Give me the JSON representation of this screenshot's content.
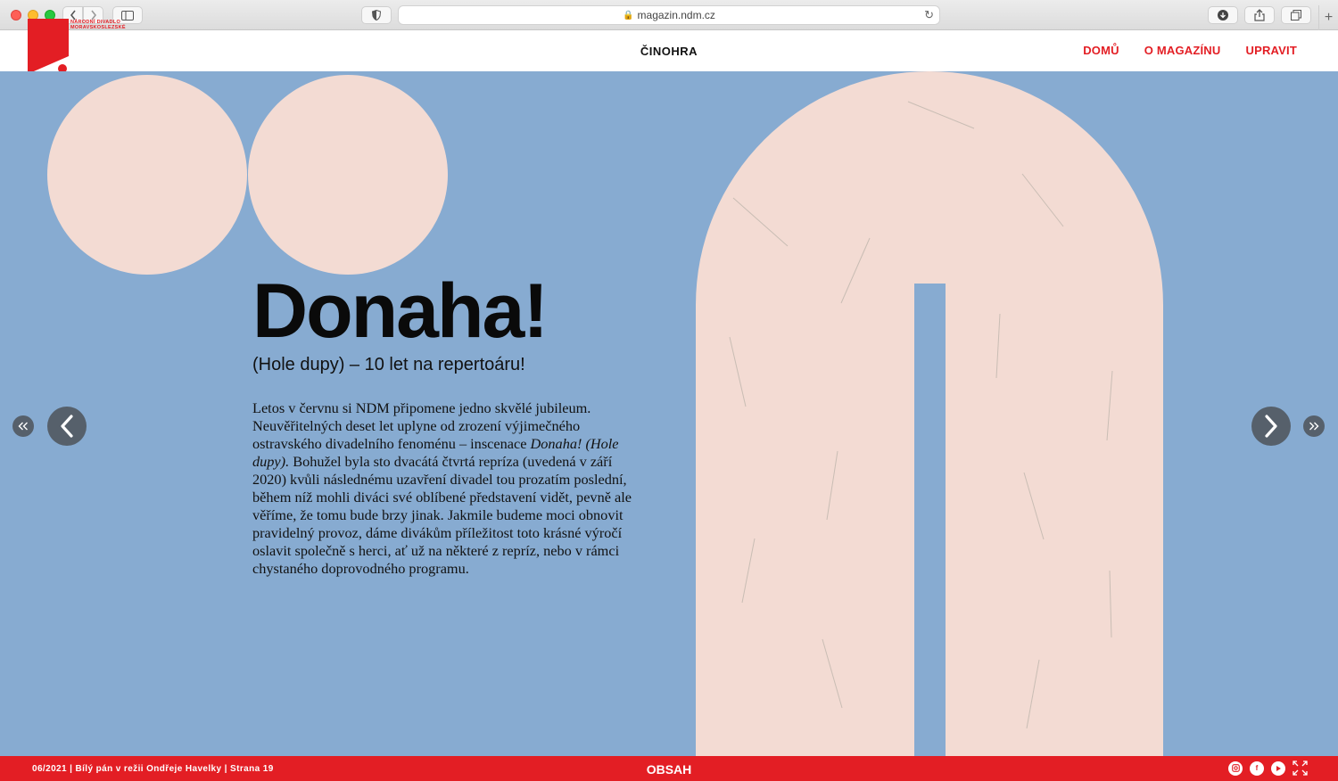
{
  "browser": {
    "url": "magazin.ndm.cz"
  },
  "header": {
    "logo_text_line1": "NÁRODNÍ DIVADLO",
    "logo_text_line2": "MORAVSKOSLEZSKÉ",
    "section_title": "ČINOHRA",
    "nav": [
      "DOMŮ",
      "O MAGAZÍNU",
      "UPRAVIT"
    ]
  },
  "article": {
    "title": "Donaha!",
    "subtitle": "(Hole dupy) – 10 let na repertoáru!",
    "body_part1": "Letos v červnu si NDM připomene jedno skvělé jubileum. Neuvěřitelných deset let uplyne od zrození výjimečného ostravského divadelního fenoménu – inscenace ",
    "body_italic": "Donaha! (Hole dupy).",
    "body_part2": " Bohužel byla sto dvacátá čtvrtá repríza (uvedená v září 2020) kvůli následnému uzavření divadel tou prozatím poslední, během níž mohli diváci své oblíbené představení vidět, pevně ale věříme, že tomu bude brzy jinak. Jakmile budeme moci obnovit pravidelný provoz, dáme divákům příležitost toto krásné výročí oslavit společně s herci, ať už na některé z repríz, nebo v rámci chystaného doprovodného programu."
  },
  "footer": {
    "info": "06/2021 | Bílý pán v režii Ondřeje Havelky | Strana 19",
    "center": "OBSAH",
    "icons": [
      "instagram-icon",
      "facebook-icon",
      "youtube-icon",
      "fullscreen-icon"
    ]
  },
  "colors": {
    "brand_red": "#e31e24",
    "stage_blue": "#87abd1",
    "shape_pink": "#f3dbd3",
    "arrow_gray": "#56606b"
  }
}
